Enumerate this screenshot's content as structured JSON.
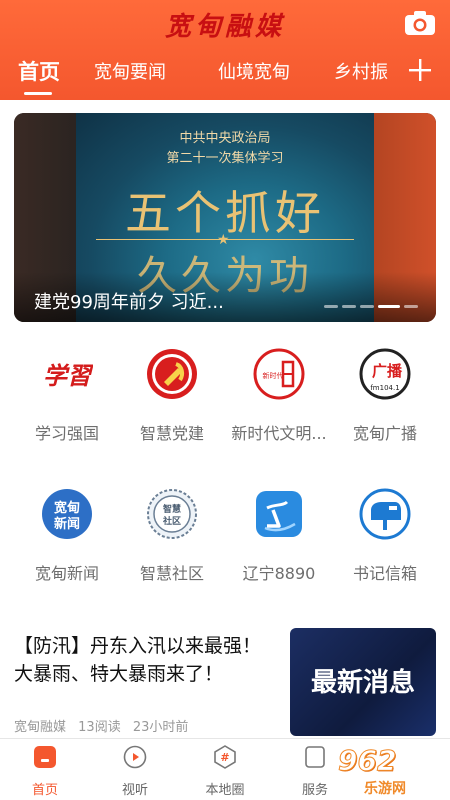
{
  "header": {
    "app_title": "宽甸融媒",
    "camera_icon": "camera-icon",
    "tabs": [
      {
        "label": "首页",
        "active": true
      },
      {
        "label": "宽甸要闻",
        "active": false
      },
      {
        "label": "仙境宽甸",
        "active": false
      },
      {
        "label": "乡村振",
        "active": false
      }
    ],
    "add_icon": "plus-icon",
    "accent": "#f4572e"
  },
  "banner": {
    "poster_line1": "中共中央政治局",
    "poster_line2": "第二十一次集体学习",
    "poster_big1": "五个抓好",
    "poster_big2": "久久为功",
    "caption": "建党99周年前夕 习近...",
    "slide_count": 5,
    "active_slide": 4
  },
  "grid": [
    {
      "label": "学习强国",
      "icon": "xuexi-logo-icon"
    },
    {
      "label": "智慧党建",
      "icon": "party-emblem-icon"
    },
    {
      "label": "新时代文明...",
      "icon": "new-era-civilization-icon"
    },
    {
      "label": "宽甸广播",
      "icon": "radio-fm-icon"
    },
    {
      "label": "宽甸新闻",
      "icon": "kuandian-news-icon"
    },
    {
      "label": "智慧社区",
      "icon": "smart-community-icon"
    },
    {
      "label": "辽宁8890",
      "icon": "liaoning-8890-icon"
    },
    {
      "label": "书记信箱",
      "icon": "mailbox-icon"
    }
  ],
  "grid_icon_text": {
    "xuexi": "学習",
    "new_era": "新时代",
    "radio": "广播",
    "radio_fm": "fm104.1",
    "news_1": "宽甸",
    "news_2": "新闻",
    "community_1": "智慧",
    "community_2": "社区"
  },
  "news": {
    "title": "【防汛】丹东入汛以来最强！大暴雨、特大暴雨来了！",
    "source": "宽甸融媒",
    "reads": "13阅读",
    "time": "23小时前",
    "thumb_text": "最新消息"
  },
  "bottom_nav": [
    {
      "label": "首页",
      "icon": "home-icon",
      "active": true
    },
    {
      "label": "视听",
      "icon": "play-icon",
      "active": false
    },
    {
      "label": "本地圈",
      "icon": "hashtag-icon",
      "active": false
    },
    {
      "label": "服务",
      "icon": "service-icon",
      "active": false
    }
  ],
  "watermark": {
    "number": "962",
    "site": "乐游网"
  }
}
